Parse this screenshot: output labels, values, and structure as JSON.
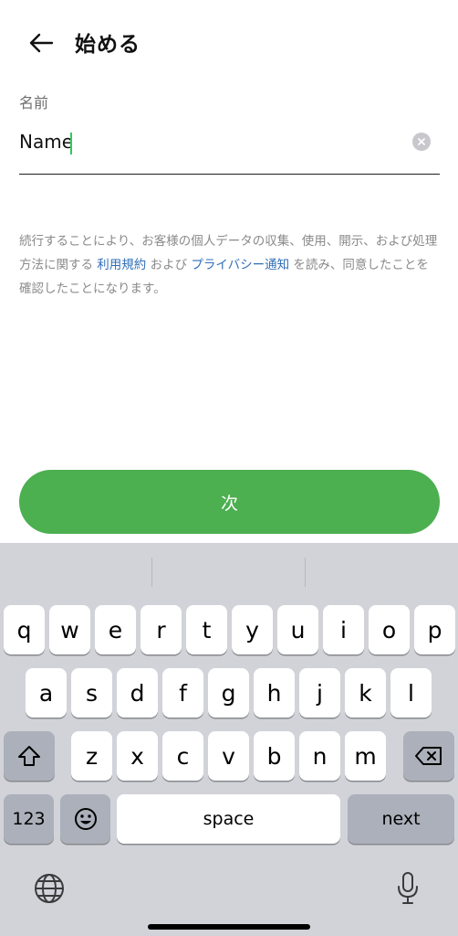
{
  "header": {
    "title": "始める",
    "back_icon": "arrow-left-icon"
  },
  "form": {
    "name_label": "名前",
    "name_value": "Name",
    "clear_icon": "clear-circle-icon"
  },
  "terms": {
    "part1": "続行することにより、お客様の個人データの収集、使用、開示、および処理方法に関する ",
    "terms_link": "利用規約",
    "part2": " および ",
    "privacy_link": "プライバシー通知",
    "part3": " を読み、同意したことを確認したことになります。"
  },
  "next_button": {
    "label": "次",
    "color": "#4caf50"
  },
  "keyboard": {
    "row1": [
      "q",
      "w",
      "e",
      "r",
      "t",
      "y",
      "u",
      "i",
      "o",
      "p"
    ],
    "row2": [
      "a",
      "s",
      "d",
      "f",
      "g",
      "h",
      "j",
      "k",
      "l"
    ],
    "row3": [
      "z",
      "x",
      "c",
      "v",
      "b",
      "n",
      "m"
    ],
    "shift_icon": "shift-icon",
    "delete_icon": "backspace-icon",
    "numbers_label": "123",
    "emoji_icon": "emoji-icon",
    "space_label": "space",
    "return_label": "next",
    "globe_icon": "globe-icon",
    "mic_icon": "microphone-icon"
  }
}
